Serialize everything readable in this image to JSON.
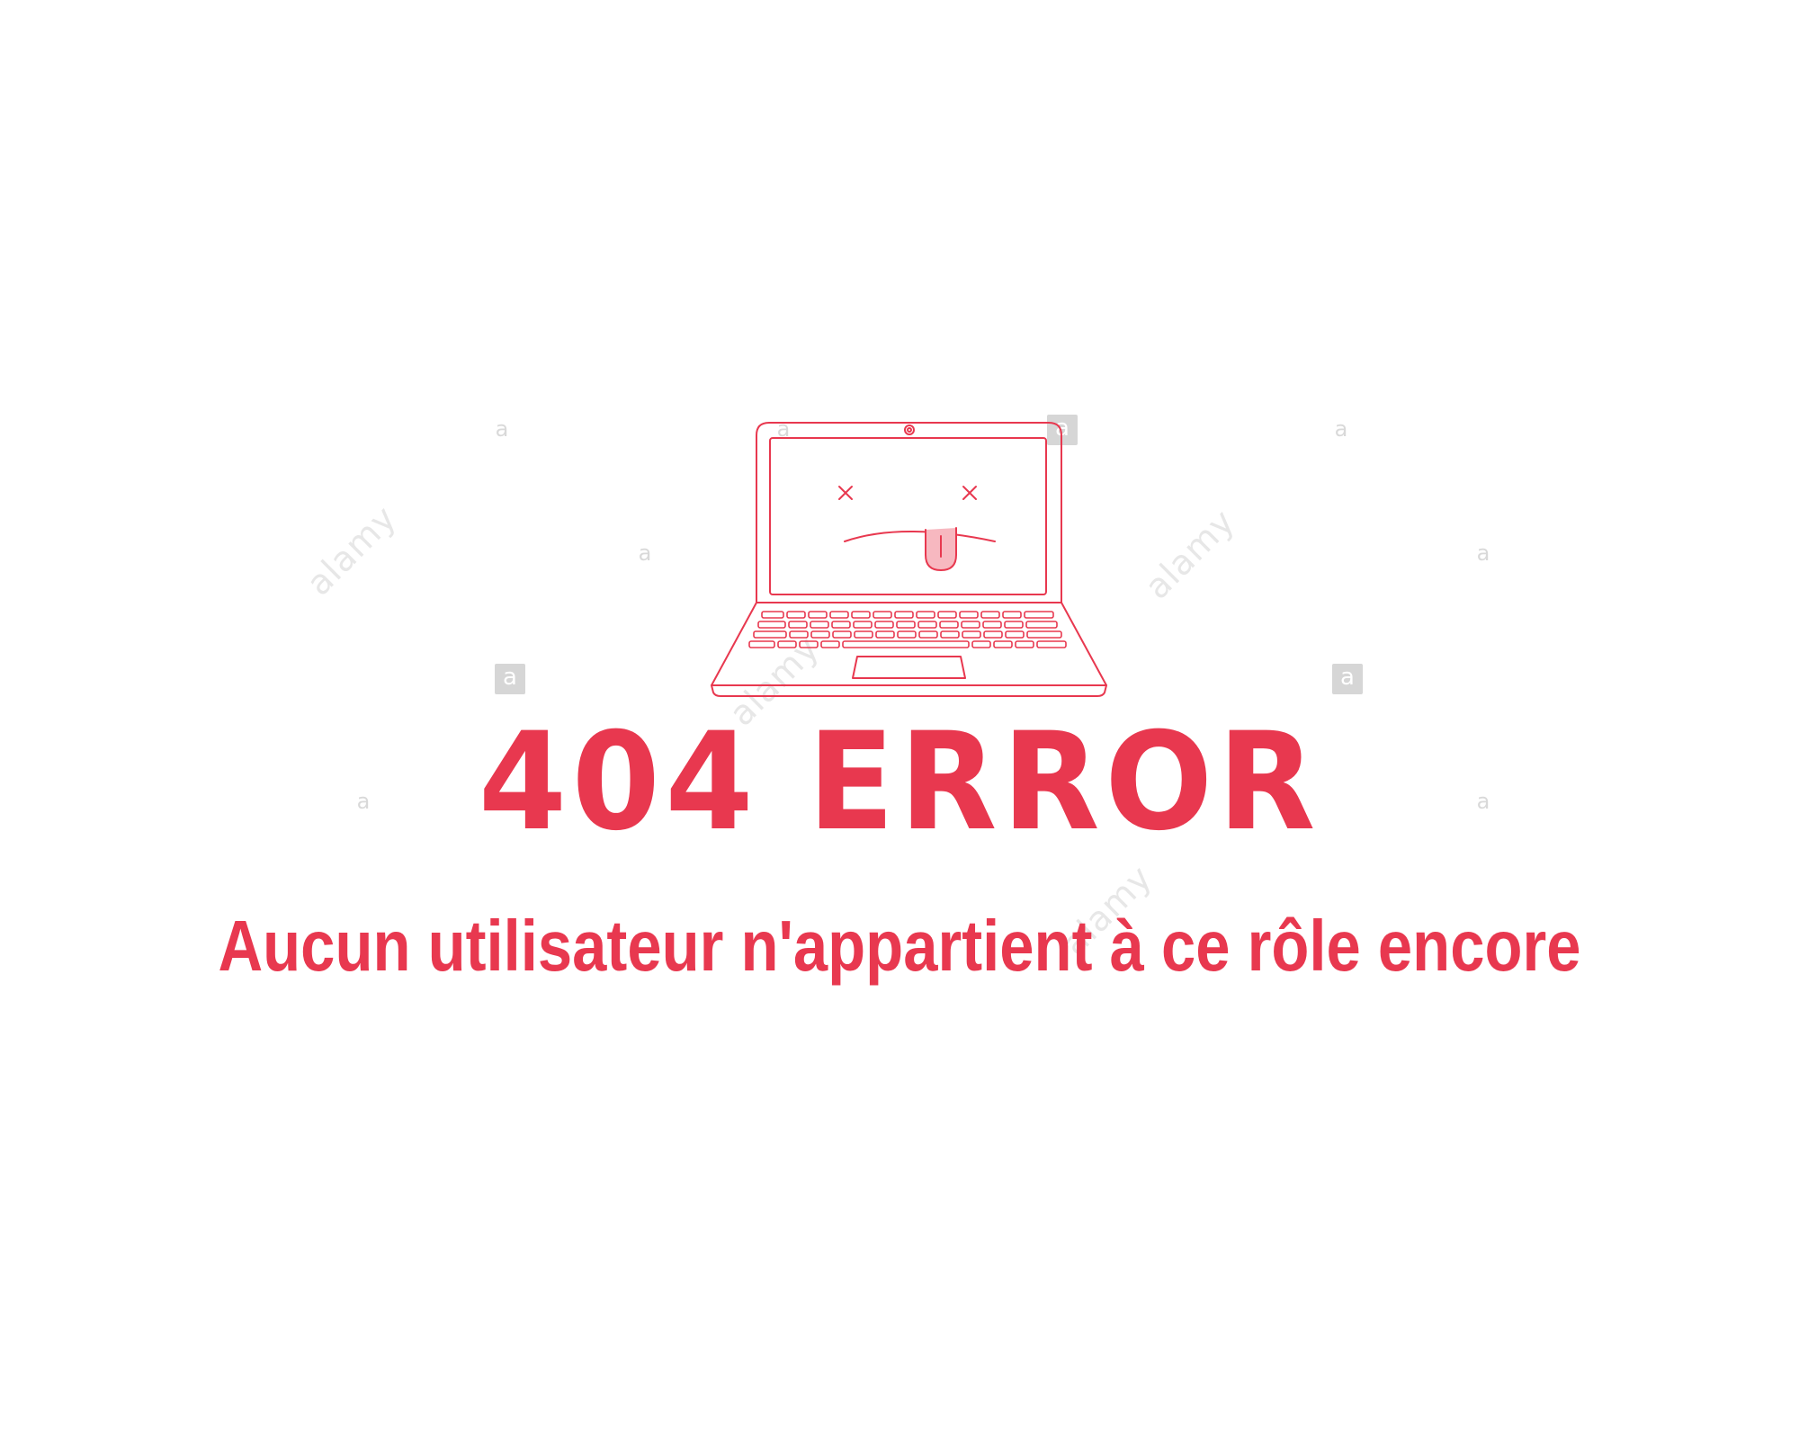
{
  "error": {
    "code_title": "404 ERROR",
    "message": "Aucun utilisateur n'appartient à ce rôle encore"
  },
  "illustration": {
    "icon": "broken-laptop-icon",
    "face_icon": "dead-face-tongue-out-icon"
  },
  "watermark": {
    "brand_text": "alamy",
    "badge_letter": "a"
  },
  "colors": {
    "accent": "#e8384f",
    "background": "#ffffff",
    "watermark": "#d6d6d6"
  }
}
